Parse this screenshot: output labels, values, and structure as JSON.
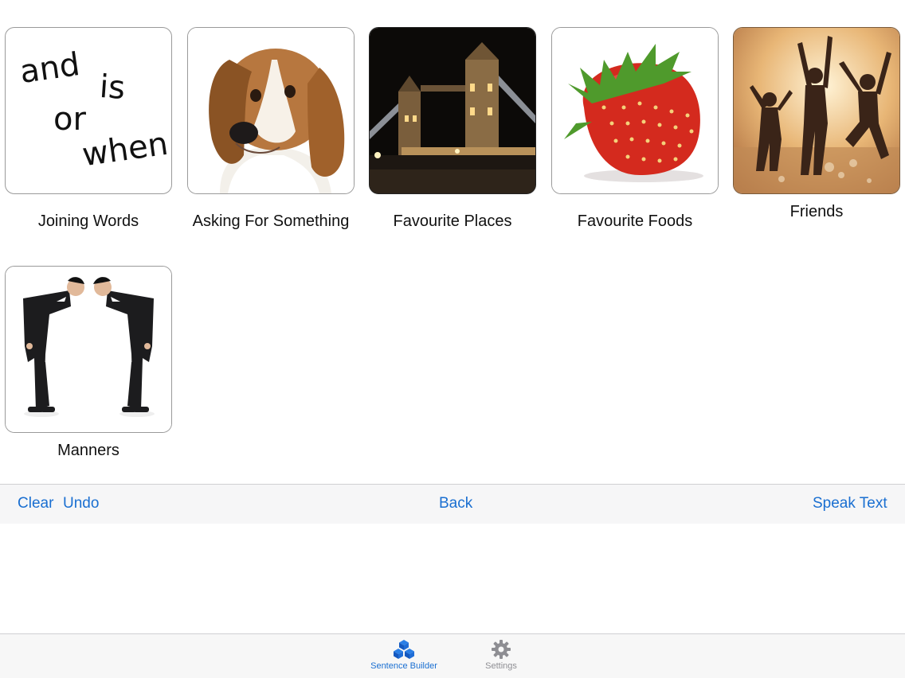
{
  "tiles": [
    {
      "label": "Joining Words",
      "words": [
        "and",
        "is",
        "or",
        "when"
      ]
    },
    {
      "label": "Asking For Something"
    },
    {
      "label": "Favourite Places"
    },
    {
      "label": "Favourite Foods"
    },
    {
      "label": "Friends"
    },
    {
      "label": "Manners"
    }
  ],
  "toolbar": {
    "clear_label": "Clear",
    "undo_label": "Undo",
    "back_label": "Back",
    "speak_label": "Speak Text"
  },
  "tabs": [
    {
      "label": "Sentence Builder",
      "icon": "cubes-icon",
      "active": true
    },
    {
      "label": "Settings",
      "icon": "gear-icon",
      "active": false
    }
  ],
  "colors": {
    "accent": "#1a6fd1",
    "toolbar_bg": "#f6f6f7",
    "inactive_tab": "#8e8e93"
  }
}
